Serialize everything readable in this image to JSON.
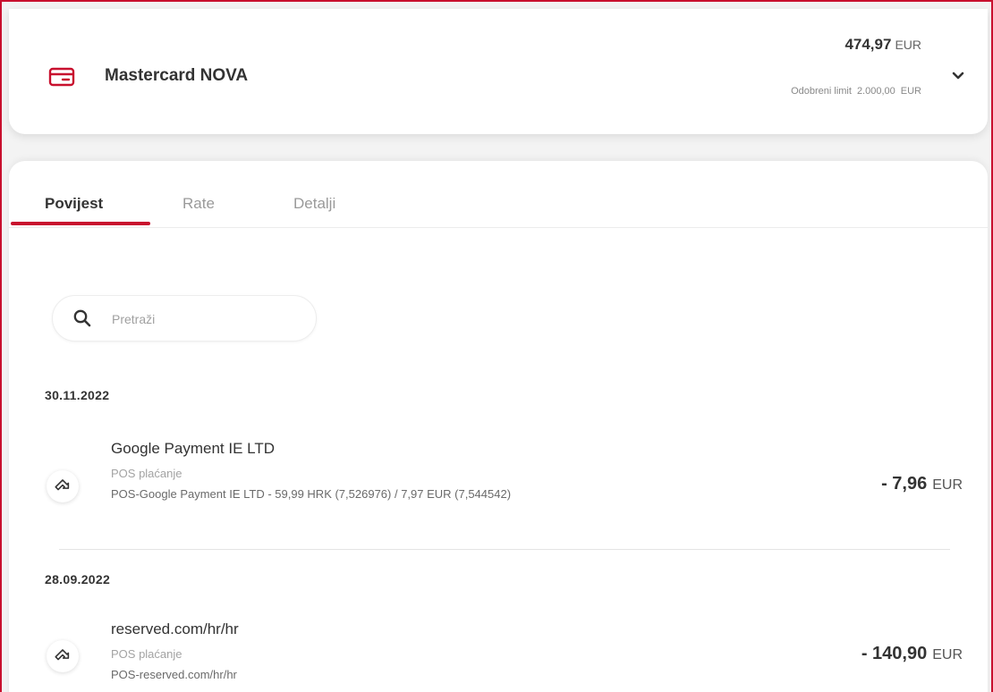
{
  "card": {
    "name": "Mastercard NOVA",
    "balance": "474,97",
    "balance_currency": "EUR",
    "limit_label": "Odobreni limit",
    "limit_value": "2.000,00",
    "limit_currency": "EUR",
    "icon": "credit-card-icon",
    "accent_color": "#c8102e"
  },
  "tabs": [
    {
      "label": "Povijest",
      "active": true
    },
    {
      "label": "Rate",
      "active": false
    },
    {
      "label": "Detalji",
      "active": false
    }
  ],
  "search": {
    "placeholder": "Pretraži",
    "value": ""
  },
  "groups": [
    {
      "date": "30.11.2022",
      "transactions": [
        {
          "title": "Google Payment IE LTD",
          "type": "POS plaćanje",
          "description": "POS-Google Payment IE LTD - 59,99 HRK (7,526976) / 7,97 EUR (7,544542)",
          "amount": "- 7,96",
          "currency": "EUR",
          "icon": "outgoing-arrow-icon"
        }
      ]
    },
    {
      "date": "28.09.2022",
      "transactions": [
        {
          "title": "reserved.com/hr/hr",
          "type": "POS plaćanje",
          "description": "POS-reserved.com/hr/hr",
          "amount": "- 140,90",
          "currency": "EUR",
          "icon": "outgoing-arrow-icon"
        }
      ]
    }
  ]
}
